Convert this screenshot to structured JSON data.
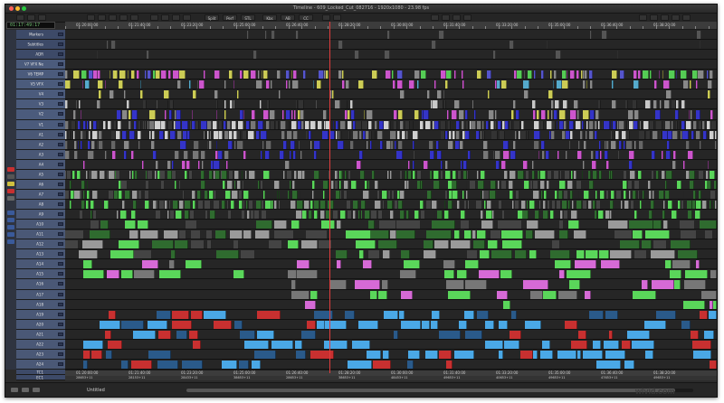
{
  "window": {
    "title": "Timeline - 609_Locked_Cut_082716 - 1920x1080 - 23.98 fps",
    "controls": [
      "close",
      "minimize",
      "zoom"
    ],
    "control_colors": [
      "#ff5f57",
      "#febc2e",
      "#28c840"
    ]
  },
  "toolbar": {
    "buttons": [
      {
        "label": "Split",
        "icon": "split-icon"
      },
      {
        "label": "Perf",
        "icon": "perf-icon"
      },
      {
        "label": "STL",
        "icon": "stl-icon"
      },
      {
        "label": "Kbs",
        "icon": "kbs-icon"
      },
      {
        "label": "AB",
        "icon": "ab-icon"
      },
      {
        "label": "CC",
        "icon": "cc-icon"
      }
    ]
  },
  "timecode": {
    "value": "01:17:49:17"
  },
  "ruler": {
    "labels": [
      "01:20:00:00",
      "01:21:40:00",
      "01:23:20:00",
      "01:25:00:00",
      "01:26:40:00",
      "01:28:20:00",
      "01:30:00:00",
      "01:31:40:00",
      "01:33:20:00",
      "01:35:00:00",
      "01:36:40:00",
      "01:38:20:00"
    ]
  },
  "ruler_bottom": {
    "labels": [
      "01:20:00:00",
      "01:21:40:00",
      "01:23:20:00",
      "01:25:00:00",
      "01:26:40:00",
      "01:28:20:00",
      "01:30:00:00",
      "01:31:40:00",
      "01:33:20:00",
      "01:35:00:00",
      "01:36:40:00",
      "01:38:20:00"
    ],
    "frames": [
      "28653+11",
      "28153+11",
      "28433+11",
      "38653+11",
      "28653+11",
      "38653+11",
      "48453+11",
      "49653+11",
      "40653+11",
      "49653+11",
      "47653+11",
      "49653+11"
    ]
  },
  "tracks": [
    {
      "name": "Markers",
      "kind": "x"
    },
    {
      "name": "Subtitles",
      "kind": "x"
    },
    {
      "name": "ADR",
      "kind": "x"
    },
    {
      "name": "V7 VFX Ne",
      "kind": "v"
    },
    {
      "name": "V6 TEMP",
      "kind": "v"
    },
    {
      "name": "V5 VFX",
      "kind": "v"
    },
    {
      "name": "V4",
      "kind": "v"
    },
    {
      "name": "V3",
      "kind": "v"
    },
    {
      "name": "V2",
      "kind": "v"
    },
    {
      "name": "V1",
      "kind": "v"
    },
    {
      "name": "A1",
      "kind": "a"
    },
    {
      "name": "A2",
      "kind": "a"
    },
    {
      "name": "A3",
      "kind": "a"
    },
    {
      "name": "A4",
      "kind": "a"
    },
    {
      "name": "A5",
      "kind": "a"
    },
    {
      "name": "A6",
      "kind": "a"
    },
    {
      "name": "A7",
      "kind": "a"
    },
    {
      "name": "A8",
      "kind": "a"
    },
    {
      "name": "A9",
      "kind": "a"
    },
    {
      "name": "A10",
      "kind": "a"
    },
    {
      "name": "A11",
      "kind": "a"
    },
    {
      "name": "A12",
      "kind": "a"
    },
    {
      "name": "A13",
      "kind": "a"
    },
    {
      "name": "A14",
      "kind": "a"
    },
    {
      "name": "A15",
      "kind": "a"
    },
    {
      "name": "A16",
      "kind": "a"
    },
    {
      "name": "A17",
      "kind": "a"
    },
    {
      "name": "A18",
      "kind": "a"
    },
    {
      "name": "A19",
      "kind": "a"
    },
    {
      "name": "A20",
      "kind": "a"
    },
    {
      "name": "A21",
      "kind": "a"
    },
    {
      "name": "A22",
      "kind": "a"
    },
    {
      "name": "A23",
      "kind": "a"
    },
    {
      "name": "A24",
      "kind": "a"
    }
  ],
  "bottom_ruler_rows": [
    "TC1",
    "EC1"
  ],
  "bottom_bar": {
    "sequence": "Untitled"
  },
  "watermark": "wlvid.com",
  "colors": {
    "video": "#8a8a8a",
    "video_dark": "#333333",
    "dialogue": "#5ad65a",
    "music": "#4aa8e6",
    "sfx_pink": "#d66ad6",
    "blue_clip": "#3434c8",
    "red_clip": "#c83030",
    "yellow_clip": "#cccc55",
    "playhead": "#e03c3c"
  }
}
